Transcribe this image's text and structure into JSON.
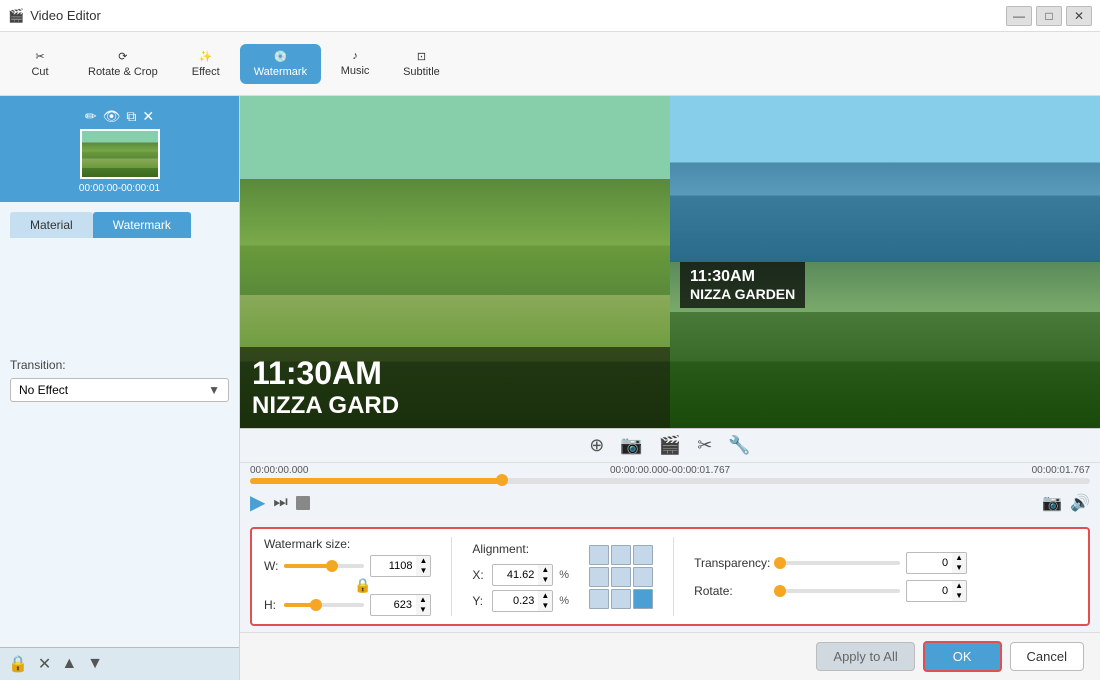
{
  "app": {
    "title": "Video Editor",
    "title_icon": "🎬"
  },
  "title_bar": {
    "controls": {
      "minimize": "—",
      "maximize": "□",
      "close": "✕"
    }
  },
  "toolbar": {
    "buttons": [
      {
        "id": "cut",
        "label": "Cut",
        "icon": "✂"
      },
      {
        "id": "rotate",
        "label": "Rotate & Crop",
        "icon": "⟳"
      },
      {
        "id": "effect",
        "label": "Effect",
        "icon": "✨"
      },
      {
        "id": "watermark",
        "label": "Watermark",
        "icon": "💿",
        "active": true
      },
      {
        "id": "music",
        "label": "Music",
        "icon": "♪"
      },
      {
        "id": "subtitle",
        "label": "Subtitle",
        "icon": "⊡"
      }
    ]
  },
  "sidebar": {
    "clip": {
      "time": "00:00:00-00:00:01"
    },
    "tabs": [
      {
        "id": "material",
        "label": "Material"
      },
      {
        "id": "watermark",
        "label": "Watermark",
        "active": true
      }
    ],
    "transition": {
      "label": "Transition:",
      "value": "No Effect"
    }
  },
  "video": {
    "left": {
      "time_text": "11:30AM",
      "place_text": "NIZZA GARD"
    },
    "right": {
      "time_text": "11:30AM",
      "place_text": "NIZZA GARDEN"
    }
  },
  "timeline": {
    "icons": [
      "➕",
      "📷",
      "🎬",
      "✂",
      "🔧"
    ],
    "time_start": "00:00:00.000",
    "time_middle": "00:00:00.000-00:00:01.767",
    "time_end": "00:00:01.767"
  },
  "watermark_panel": {
    "size_label": "Watermark size:",
    "w_label": "W:",
    "w_value": "1108",
    "h_label": "H:",
    "h_value": "623",
    "alignment_label": "Alignment:",
    "x_label": "X:",
    "x_value": "41.62",
    "y_label": "Y:",
    "y_value": "0.23",
    "pct": "%",
    "transparency_label": "Transparency:",
    "transparency_value": "0",
    "rotate_label": "Rotate:",
    "rotate_value": "0"
  },
  "bottom_bar": {
    "apply_label": "Apply to All",
    "ok_label": "OK",
    "cancel_label": "Cancel"
  }
}
